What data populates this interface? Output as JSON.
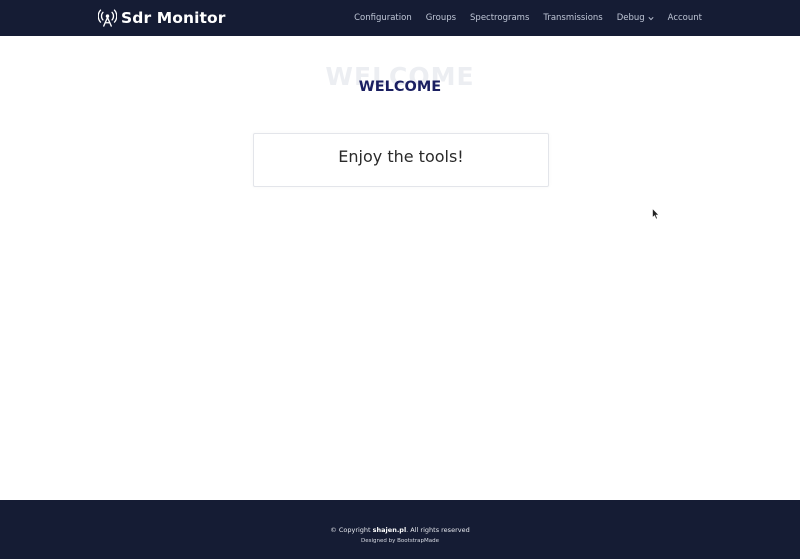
{
  "header": {
    "brand": "Sdr Monitor",
    "brand_icon": "broadcast-tower-icon",
    "nav": [
      {
        "label": "Configuration"
      },
      {
        "label": "Groups"
      },
      {
        "label": "Spectrograms"
      },
      {
        "label": "Transmissions"
      },
      {
        "label": "Debug",
        "has_dropdown": true
      },
      {
        "label": "Account"
      }
    ]
  },
  "main": {
    "title_ghost": "WELCOME",
    "title": "WELCOME",
    "card_text": "Enjoy the tools!"
  },
  "footer": {
    "copyright_prefix": "© Copyright",
    "copyright_site": "shajen.pl",
    "copyright_suffix": ". All rights reserved",
    "designed_by": "Designed by BootstrapMade"
  },
  "colors": {
    "header_bg": "#151c34",
    "title_color": "#1a1f61",
    "nav_text": "#bfc6d6",
    "footer_bg": "#151c34"
  }
}
